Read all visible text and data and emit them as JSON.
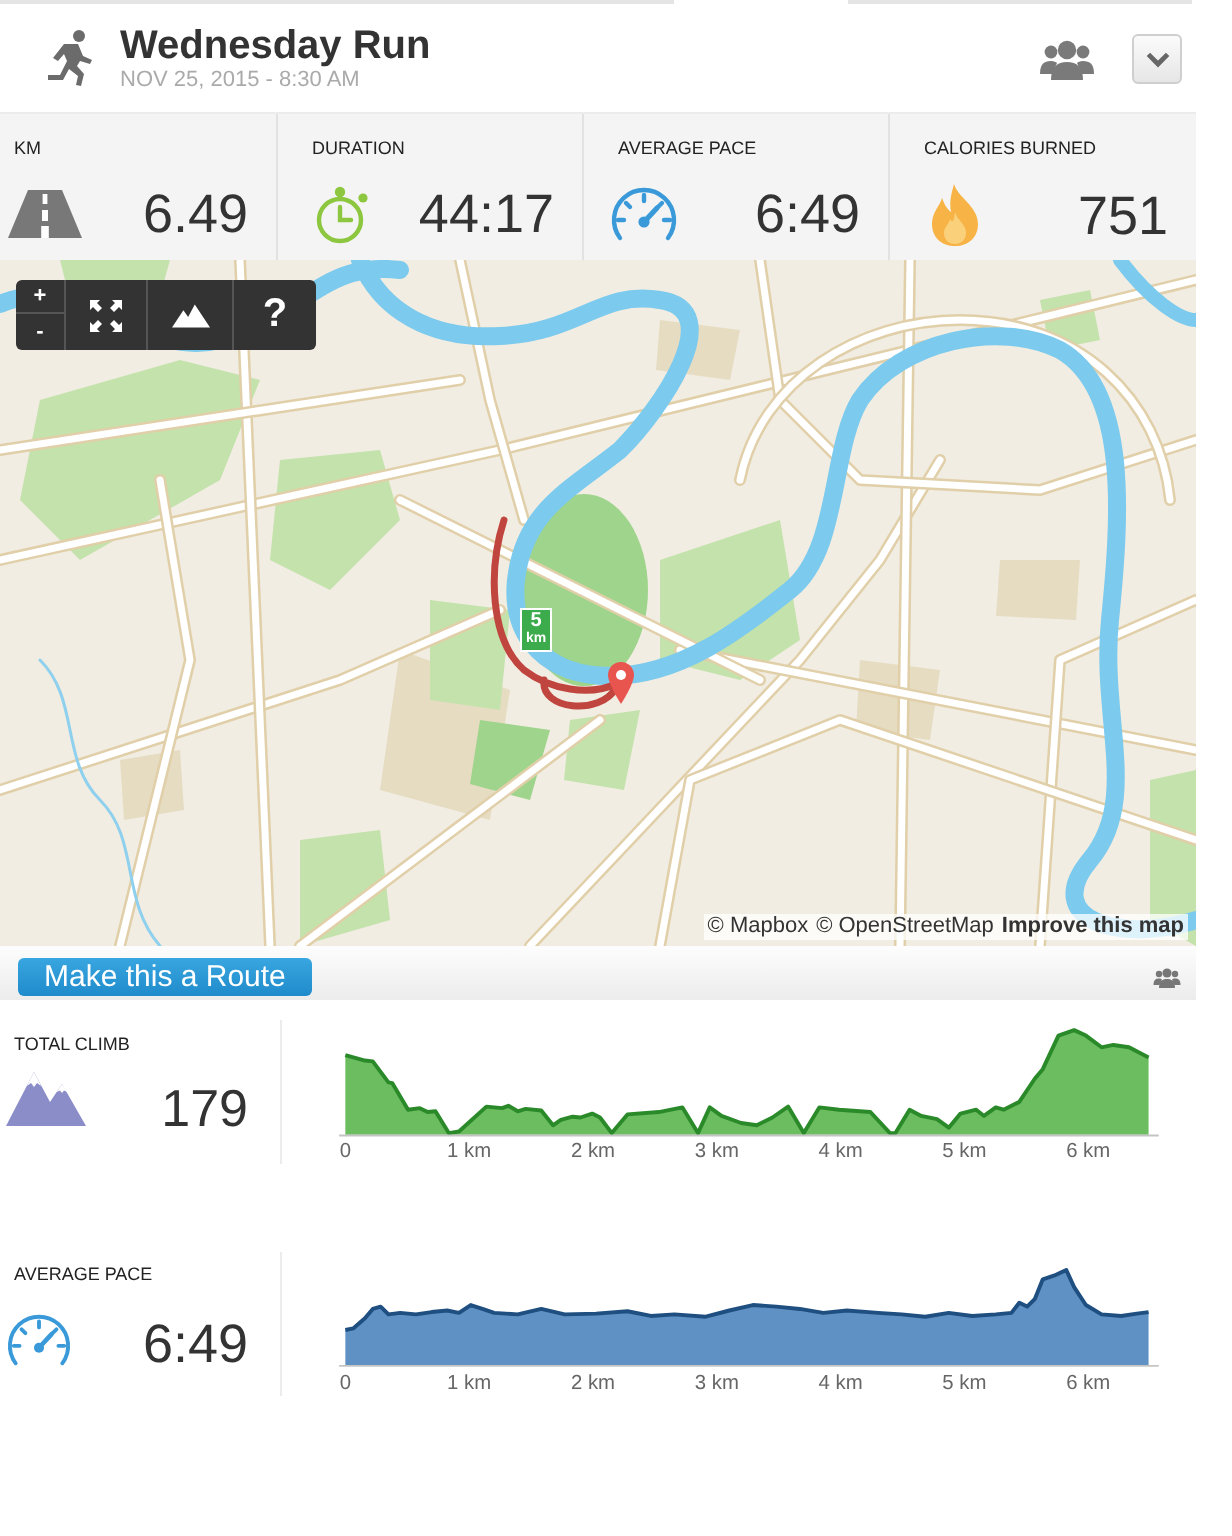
{
  "header": {
    "title": "Wednesday Run",
    "datetime": "NOV 25, 2015 - 8:30 AM"
  },
  "stats": [
    {
      "kind": "distance",
      "label": "KM",
      "value": "6.49"
    },
    {
      "kind": "duration",
      "label": "DURATION",
      "value": "44:17"
    },
    {
      "kind": "pace",
      "label": "AVERAGE PACE",
      "value": "6:49"
    },
    {
      "kind": "calories",
      "label": "CALORIES BURNED",
      "value": "751"
    }
  ],
  "map": {
    "controls": {
      "zoom_in": "+",
      "zoom_out": "-",
      "help": "?"
    },
    "distance_marker": {
      "value": "5",
      "unit": "km"
    },
    "attribution": {
      "mapbox": "© Mapbox",
      "osm": "© OpenStreetMap",
      "improve": "Improve this map"
    }
  },
  "route_bar": {
    "button": "Make this a Route"
  },
  "charts": [
    {
      "kind": "elevation",
      "label": "TOTAL CLIMB",
      "value": "179",
      "axis_labels": [
        "0",
        "1 km",
        "2 km",
        "3 km",
        "4 km",
        "5 km",
        "6 km"
      ]
    },
    {
      "kind": "pace",
      "label": "AVERAGE PACE",
      "value": "6:49",
      "axis_labels": [
        "0",
        "1 km",
        "2 km",
        "3 km",
        "4 km",
        "5 km",
        "6 km"
      ]
    }
  ]
}
